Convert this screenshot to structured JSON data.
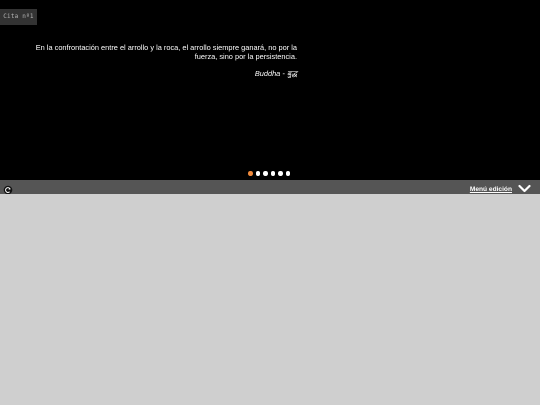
{
  "slider": {
    "tag": "Cita nº1",
    "quote": "En la confrontación entre el arrollo y la roca, el arrollo siempre ganará, no por la fuerza, sino por la persistencia.",
    "author": "Buddha - बुद्ध",
    "dots": {
      "count": 6,
      "active_index": 0
    }
  },
  "toolbar": {
    "refresh_icon": "refresh-icon",
    "menu_label": "Menú edición",
    "menu_icon": "chevron-down-icon"
  },
  "colors": {
    "slider_bg": "#000000",
    "toolbar_bg": "#555555",
    "content_bg": "#cfcfcf",
    "active_dot": "#f08a3c"
  }
}
